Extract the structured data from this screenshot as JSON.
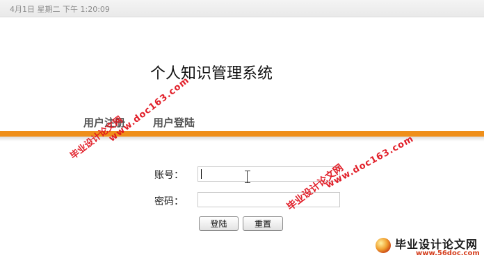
{
  "statusbar": {
    "datetime": "4月1日  星期二  下午  1:20:09"
  },
  "page": {
    "title": "个人知识管理系统"
  },
  "nav": {
    "register": "用户注册",
    "login": "用户登陆"
  },
  "form": {
    "account_label": "账号：",
    "account_value": "",
    "password_label": "密码：",
    "password_value": "",
    "login_button": "登陆",
    "reset_button": "重置"
  },
  "colors": {
    "accent_band": "#ef8f1a",
    "watermark": "#e0141e"
  },
  "watermarks": {
    "text1": "毕业设计论文网",
    "text2": "www.doc163.com",
    "text3": "毕业设计论文网",
    "text4": "www.doc163.com"
  },
  "logo": {
    "name": "毕业设计论文网",
    "url": "www.56doc.com"
  }
}
